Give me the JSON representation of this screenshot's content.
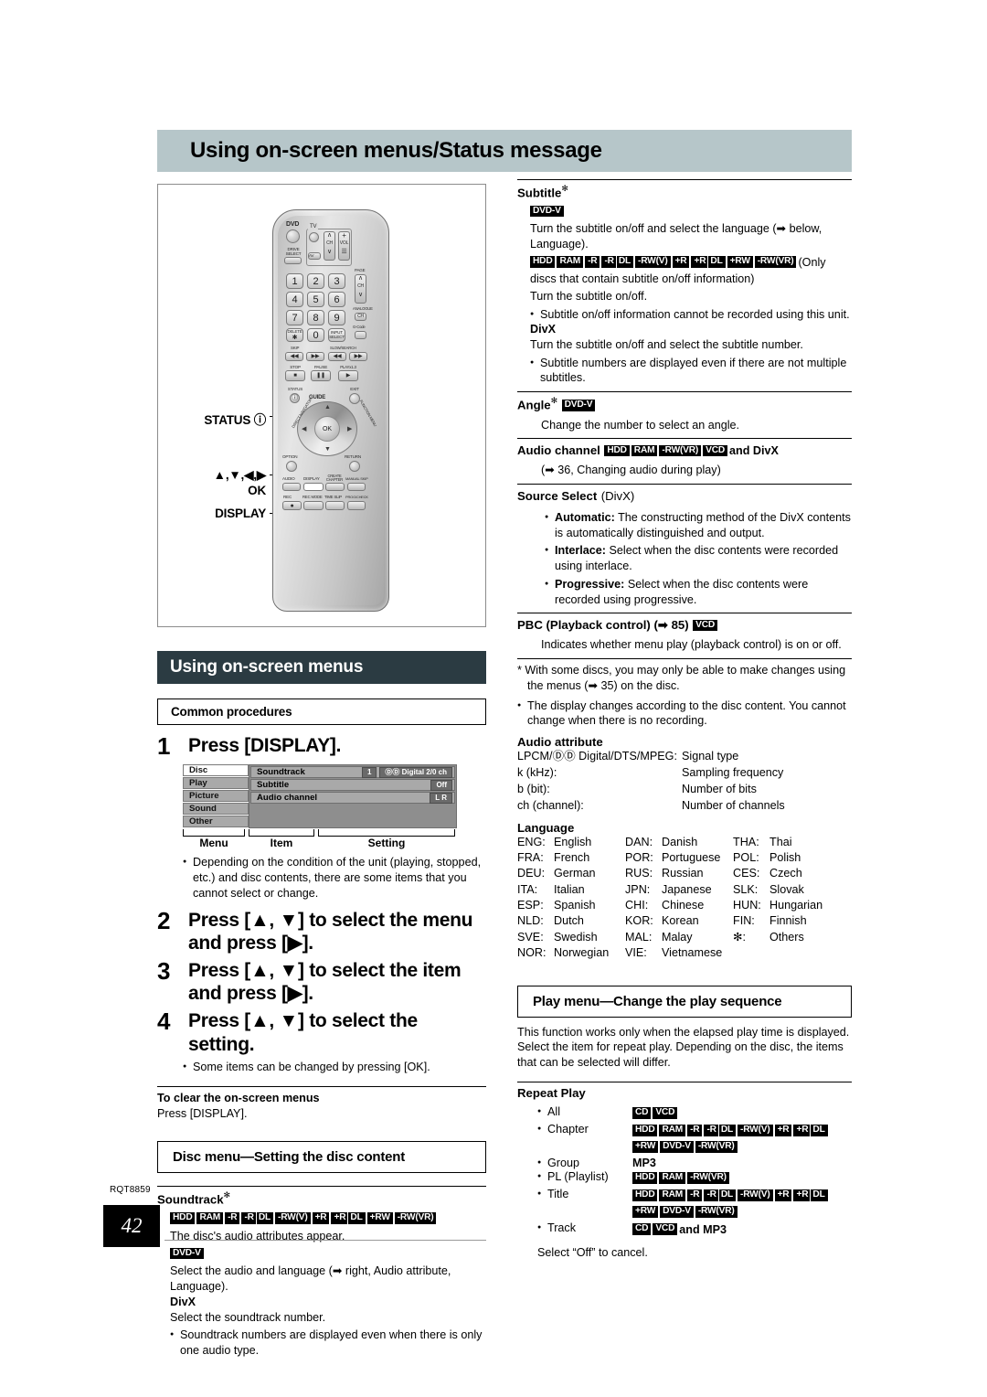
{
  "banner": {
    "title": "Using on-screen menus/Status message"
  },
  "remote": {
    "callouts": [
      {
        "label": "STATUS ⓘ"
      },
      {
        "label": "▲,▼,◀,▶"
      },
      {
        "label": "OK"
      },
      {
        "label": "DISPLAY"
      }
    ],
    "buttons": {
      "dvd": "DVD",
      "drive_select": "DRIVE\nSELECT",
      "tv": "TV",
      "av": "AV",
      "ch": "CH",
      "vol": "VOL",
      "page": "PAGE",
      "analogue": "ANALOGUE",
      "analogue_ch": "CH",
      "gcode": "G-Code",
      "delete": "DELETE",
      "input_select": "INPUT\nSELECT",
      "skip": "SKIP",
      "slow_search": "SLOW/SEARCH",
      "stop": "STOP",
      "pause": "PAUSE",
      "play": "PLAYx1.3",
      "status": "STATUS",
      "exit": "EXIT",
      "guide": "GUIDE",
      "direct_navigator": "DIRECT NAVIGATOR",
      "function_menu": "FUNCTION MENU",
      "option": "OPTION",
      "return": "RETURN",
      "audio": "AUDIO",
      "display": "DISPLAY",
      "create_chapter": "CREATE\nCHAPTER",
      "manual_skip": "MANUAL SKIP",
      "rec": "REC",
      "rec_mode": "REC MODE",
      "time_slip": "TIME SLIP",
      "prog_check": "PROG/CHECK",
      "ok": "OK",
      "numbers": [
        "1",
        "2",
        "3",
        "4",
        "5",
        "6",
        "7",
        "8",
        "9",
        "0"
      ]
    }
  },
  "left": {
    "section_header": "Using on-screen menus",
    "common_procedures": "Common procedures",
    "step1": {
      "num": "1",
      "text": "Press [DISPLAY]."
    },
    "osd": {
      "menu_items": [
        "Disc",
        "Play",
        "Picture",
        "Sound",
        "Other"
      ],
      "selected_menu": "Disc",
      "rows": [
        {
          "item": "Soundtrack",
          "value1": "1",
          "value2": "ⒹⒹ Digital  2/0 ch"
        },
        {
          "item": "Subtitle",
          "value1": "",
          "value2": "Off"
        },
        {
          "item": "Audio channel",
          "value1": "",
          "value2": "L R"
        }
      ],
      "captions": [
        "Menu",
        "Item",
        "Setting"
      ]
    },
    "note1": "Depending on the condition of the unit (playing, stopped, etc.) and disc contents, there are some items that you cannot select or change.",
    "step2": {
      "num": "2",
      "text": "Press [▲, ▼] to select the menu and press [▶]."
    },
    "step3": {
      "num": "3",
      "text": "Press [▲, ▼] to select the item and press [▶]."
    },
    "step4": {
      "num": "4",
      "text": "Press [▲, ▼] to select the setting."
    },
    "note2": "Some items can be changed by pressing [OK].",
    "clear_title": "To clear the on-screen menus",
    "clear_text": "Press [DISPLAY].",
    "disc_menu_head": "Disc menu—Setting the disc content",
    "soundtrack": {
      "title": "Soundtrack",
      "title_sup": "✻",
      "badges1": [
        "HDD",
        "RAM",
        "-R",
        "-R|DL",
        "-RW(V)",
        "+R",
        "+R|DL",
        "+RW",
        "-RW(VR)"
      ],
      "line1": "The disc's audio attributes appear.",
      "badge2": "DVD-V",
      "line2": "Select the audio and language (➡ right, Audio attribute, Language).",
      "divx_label": "DivX",
      "line3": "Select the soundtrack number.",
      "bullet": "Soundtrack numbers are displayed even when there is only one audio type."
    }
  },
  "right": {
    "subtitle": {
      "title": "Subtitle",
      "title_sup": "✻",
      "badge1": "DVD-V",
      "line1": "Turn the subtitle on/off and select the language (➡ below, Language).",
      "badges2": [
        "HDD",
        "RAM",
        "-R",
        "-R|DL",
        "-RW(V)",
        "+R",
        "+R|DL",
        "+RW",
        "-RW(VR)"
      ],
      "badges2_tail": "(Only discs that contain subtitle on/off information)",
      "line2": "Turn the subtitle on/off.",
      "bullet1": "Subtitle on/off information cannot be recorded using this unit.",
      "divx_label": "DivX",
      "line3": "Turn the subtitle on/off and select the subtitle number.",
      "bullet2": "Subtitle numbers are displayed even if there are not multiple subtitles."
    },
    "angle": {
      "title": "Angle",
      "title_sup": "✻",
      "badge": "DVD-V",
      "line": "Change the number to select an angle."
    },
    "audio_channel": {
      "title": "Audio channel",
      "badges": [
        "HDD",
        "RAM",
        "-RW(VR)",
        "VCD"
      ],
      "tail": "and DivX",
      "line": "(➡ 36, Changing audio during play)"
    },
    "source_select": {
      "title": "Source Select",
      "title_paren": "(DivX)",
      "items": [
        {
          "name": "Automatic:",
          "desc": "The constructing method of the DivX contents is automatically distinguished and output."
        },
        {
          "name": "Interlace:",
          "desc": "Select when the disc contents were recorded using interlace."
        },
        {
          "name": "Progressive:",
          "desc": "Select when the disc contents were recorded using progressive."
        }
      ]
    },
    "pbc": {
      "title": "PBC (Playback control) (➡ 85)",
      "badge": "VCD",
      "line": "Indicates whether menu play (playback control) is on or off."
    },
    "footnote": "* With some discs, you may only be able to make changes using the menus (➡ 35) on the disc.",
    "footbullet": "The display changes according to the disc content. You cannot change when there is no recording.",
    "audio_attribute": {
      "title": "Audio attribute",
      "rows": [
        {
          "c1": "LPCM/ⒹⒹ Digital/DTS/MPEG:",
          "c2": "Signal type"
        },
        {
          "c1": "k (kHz):",
          "c2": "Sampling frequency"
        },
        {
          "c1": "b (bit):",
          "c2": "Number of bits"
        },
        {
          "c1": "ch (channel):",
          "c2": "Number of channels"
        }
      ]
    },
    "language": {
      "title": "Language",
      "col1": [
        {
          "code": "ENG:",
          "name": "English"
        },
        {
          "code": "FRA:",
          "name": "French"
        },
        {
          "code": "DEU:",
          "name": "German"
        },
        {
          "code": "ITA:",
          "name": "Italian"
        },
        {
          "code": "ESP:",
          "name": "Spanish"
        },
        {
          "code": "NLD:",
          "name": "Dutch"
        },
        {
          "code": "SVE:",
          "name": "Swedish"
        },
        {
          "code": "NOR:",
          "name": "Norwegian"
        }
      ],
      "col2": [
        {
          "code": "DAN:",
          "name": "Danish"
        },
        {
          "code": "POR:",
          "name": "Portuguese"
        },
        {
          "code": "RUS:",
          "name": "Russian"
        },
        {
          "code": "JPN:",
          "name": "Japanese"
        },
        {
          "code": "CHI:",
          "name": "Chinese"
        },
        {
          "code": "KOR:",
          "name": "Korean"
        },
        {
          "code": "MAL:",
          "name": "Malay"
        },
        {
          "code": "VIE:",
          "name": "Vietnamese"
        }
      ],
      "col3": [
        {
          "code": "THA:",
          "name": "Thai"
        },
        {
          "code": "POL:",
          "name": "Polish"
        },
        {
          "code": "CES:",
          "name": "Czech"
        },
        {
          "code": "SLK:",
          "name": "Slovak"
        },
        {
          "code": "HUN:",
          "name": "Hungarian"
        },
        {
          "code": "FIN:",
          "name": "Finnish"
        },
        {
          "code": "✻:",
          "name": "Others"
        }
      ]
    },
    "play_menu": {
      "head": "Play menu—Change the play sequence",
      "intro": "This function works only when the elapsed play time is displayed. Select the item for repeat play. Depending on the disc, the items that can be selected will differ.",
      "repeat_title": "Repeat Play",
      "rows": [
        {
          "label": "All",
          "badges": [
            "CD",
            "VCD"
          ],
          "tail": ""
        },
        {
          "label": "Chapter",
          "badges": [
            "HDD",
            "RAM",
            "-R",
            "-R|DL",
            "-RW(V)",
            "+R",
            "+R|DL",
            "+RW",
            "DVD-V",
            "-RW(VR)"
          ],
          "tail": ""
        },
        {
          "label": "Group",
          "badges": [],
          "tail": "MP3"
        },
        {
          "label": "PL (Playlist)",
          "badges": [
            "HDD",
            "RAM",
            "-RW(VR)"
          ],
          "tail": ""
        },
        {
          "label": "Title",
          "badges": [
            "HDD",
            "RAM",
            "-R",
            "-R|DL",
            "-RW(V)",
            "+R",
            "+R|DL",
            "+RW",
            "DVD-V",
            "-RW(VR)"
          ],
          "tail": ""
        },
        {
          "label": "Track",
          "badges": [
            "CD",
            "VCD"
          ],
          "tail": "and MP3"
        }
      ],
      "cancel": "Select “Off” to cancel."
    }
  },
  "footer": {
    "rqt": "RQT8859",
    "page": "42"
  }
}
